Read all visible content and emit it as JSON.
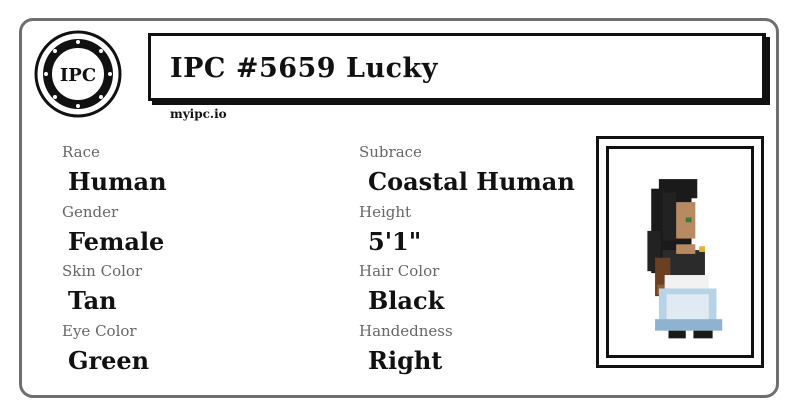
{
  "header": {
    "logo_text": "IPC",
    "title": "IPC #5659 Lucky",
    "site": "myipc.io"
  },
  "fields": {
    "race": {
      "label": "Race",
      "value": "Human"
    },
    "subrace": {
      "label": "Subrace",
      "value": "Coastal Human"
    },
    "gender": {
      "label": "Gender",
      "value": "Female"
    },
    "height": {
      "label": "Height",
      "value": "5'1\""
    },
    "skin_color": {
      "label": "Skin Color",
      "value": "Tan"
    },
    "hair_color": {
      "label": "Hair Color",
      "value": "Black"
    },
    "eye_color": {
      "label": "Eye Color",
      "value": "Green"
    },
    "handedness": {
      "label": "Handedness",
      "value": "Right"
    }
  },
  "portrait": {
    "description_icon": "pixel-character-icon"
  },
  "colors": {
    "border": "#6f6f6f",
    "text": "#111111",
    "label": "#666666"
  }
}
